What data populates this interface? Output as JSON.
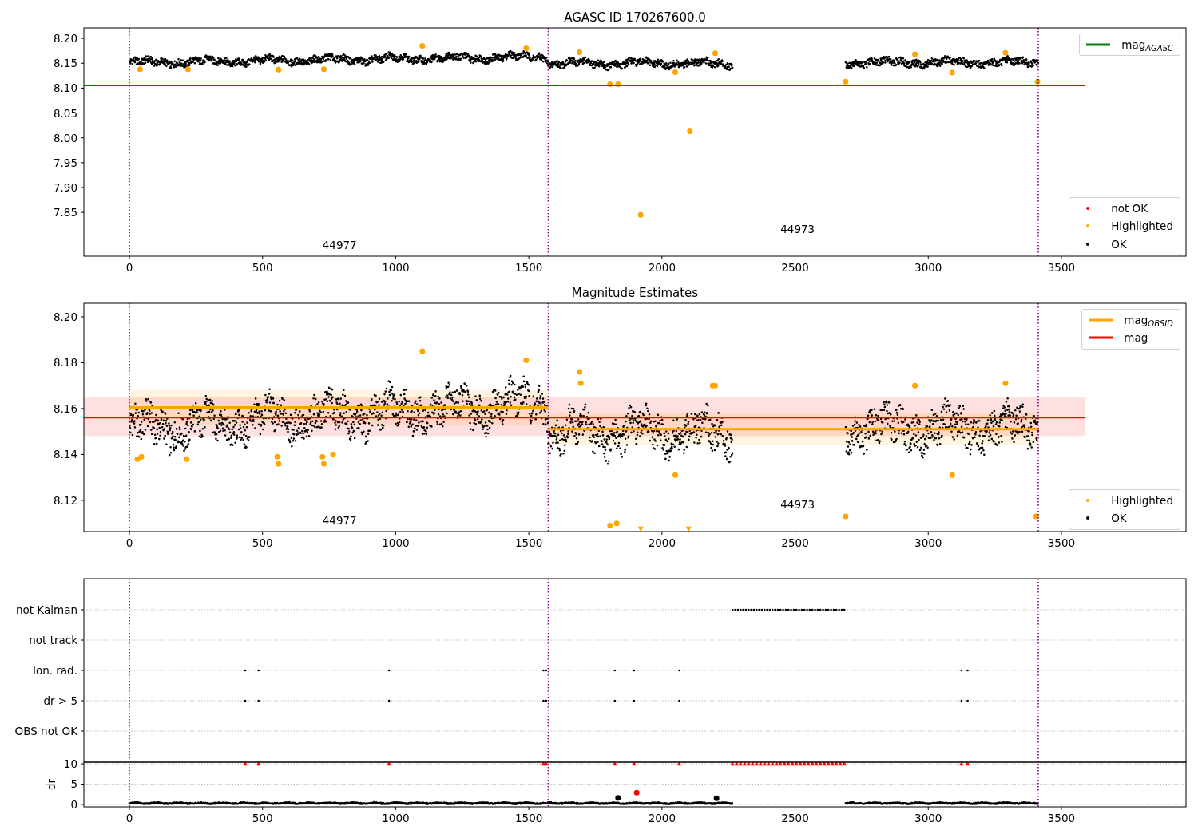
{
  "panels": [
    {
      "chart_data": {
        "type": "scatter",
        "title": "AGASC ID 170267600.0",
        "xlim": [
          -171,
          3968
        ],
        "ylim": [
          7.762,
          8.221
        ],
        "xticks": [
          0,
          500,
          1000,
          1500,
          2000,
          2500,
          3000,
          3500
        ],
        "yticks": [
          {
            "value": 7.85,
            "label": "7.85"
          },
          {
            "value": 7.9,
            "label": "7.90"
          },
          {
            "value": 7.95,
            "label": "7.95"
          },
          {
            "value": 8.0,
            "label": "8.00"
          },
          {
            "value": 8.05,
            "label": "8.05"
          },
          {
            "value": 8.1,
            "label": "8.10"
          },
          {
            "value": 8.15,
            "label": "8.15"
          },
          {
            "value": 8.2,
            "label": "8.20"
          }
        ],
        "series": [
          {
            "type": "line",
            "color": "#008000",
            "x": [
              -171,
              3590
            ],
            "values": [
              8.105,
              8.105
            ]
          },
          {
            "type": "scatter",
            "marker": "circle",
            "color": "#ffa500",
            "x": [
              40,
              220,
              560,
              730,
              1100,
              1490,
              1690,
              1805,
              1835,
              1920,
              2050,
              2105,
              2200,
              2690,
              2950,
              3090,
              3290,
              3410
            ],
            "values": [
              8.138,
              8.138,
              8.137,
              8.138,
              8.185,
              8.18,
              8.172,
              8.108,
              8.108,
              7.845,
              8.132,
              8.013,
              8.17,
              8.113,
              8.168,
              8.131,
              8.171,
              8.113
            ]
          }
        ],
        "ref_lines": [
          {
            "axis": "x",
            "value": 0,
            "color": "#800080"
          },
          {
            "axis": "x",
            "value": 1573,
            "color": "#800080"
          },
          {
            "axis": "x",
            "value": 3413,
            "color": "#800080"
          }
        ],
        "annotations": [
          "44977",
          "44973"
        ]
      },
      "legends": [
        {
          "entries": [
            {
              "label": "mag$_{AGASC}$",
              "kind": "line",
              "color": "#008000"
            }
          ]
        },
        {
          "entries": [
            {
              "label": "not OK",
              "kind": "dot",
              "color": "#ff0000"
            },
            {
              "label": "Highlighted",
              "kind": "dot",
              "color": "#ffa500"
            },
            {
              "label": "OK",
              "kind": "dot",
              "color": "#000000"
            }
          ]
        }
      ]
    },
    {
      "chart_data": {
        "type": "scatter",
        "title": "Magnitude Estimates",
        "xlim": [
          -171,
          3968
        ],
        "ylim": [
          8.1064,
          8.2059
        ],
        "xticks": [
          0,
          500,
          1000,
          1500,
          2000,
          2500,
          3000,
          3500
        ],
        "yticks": [
          {
            "value": 8.12,
            "label": "8.12"
          },
          {
            "value": 8.14,
            "label": "8.14"
          },
          {
            "value": 8.16,
            "label": "8.16"
          },
          {
            "value": 8.18,
            "label": "8.18"
          },
          {
            "value": 8.2,
            "label": "8.20"
          }
        ],
        "series": [
          {
            "type": "line",
            "color": "#ff0000",
            "x": [
              -171,
              3590
            ],
            "values": [
              8.156,
              8.156
            ]
          },
          {
            "type": "line",
            "color": "#ffa500",
            "x": [
              0,
              1573,
              null,
              1573,
              3413
            ],
            "values": [
              8.1605,
              8.1605,
              null,
              8.151,
              8.151
            ]
          },
          {
            "type": "scatter",
            "marker": "circle",
            "color": "#ffa500",
            "x": [
              30,
              45,
              215,
              555,
              560,
              725,
              730,
              765,
              1100,
              1490,
              1690,
              1695,
              1805,
              1830,
              2050,
              2190,
              2200,
              2690,
              2950,
              3090,
              3290,
              3405
            ],
            "values": [
              8.138,
              8.139,
              8.138,
              8.139,
              8.136,
              8.139,
              8.136,
              8.14,
              8.185,
              8.181,
              8.176,
              8.171,
              8.109,
              8.11,
              8.131,
              8.17,
              8.17,
              8.113,
              8.17,
              8.131,
              8.171,
              8.113
            ]
          },
          {
            "type": "scatter",
            "marker": "triangle",
            "color": "#ffa500",
            "x": [
              1920,
              2100
            ],
            "values": [
              8.1075,
              8.1075
            ]
          }
        ],
        "bands": [
          {
            "axis": "y",
            "from": 8.148,
            "to": 8.165,
            "color": "#ff0000"
          },
          {
            "axis": "y",
            "from": 8.153,
            "to": 8.168,
            "color": "#ffa500"
          },
          {
            "axis": "y",
            "from": 8.144,
            "to": 8.158,
            "color": "#ffa500"
          }
        ],
        "ref_lines": [
          {
            "axis": "x",
            "value": 0,
            "color": "#800080"
          },
          {
            "axis": "x",
            "value": 1573,
            "color": "#800080"
          },
          {
            "axis": "x",
            "value": 3413,
            "color": "#800080"
          }
        ],
        "annotations": [
          "44977",
          "44973"
        ]
      },
      "legends": [
        {
          "entries": [
            {
              "label": "mag$_{OBSID}$",
              "kind": "line",
              "color": "#ffa500"
            },
            {
              "label": "mag",
              "kind": "line",
              "color": "#ff0000"
            }
          ]
        },
        {
          "entries": [
            {
              "label": "Highlighted",
              "kind": "dot",
              "color": "#ffa500"
            },
            {
              "label": "OK",
              "kind": "dot",
              "color": "#000000"
            }
          ]
        }
      ]
    },
    {
      "flag_rows": [
        {
          "label": "not Kalman"
        },
        {
          "label": "not track"
        },
        {
          "label": "Ion. rad."
        },
        {
          "label": "dr > 5"
        },
        {
          "label": "OBS not OK"
        }
      ]
    },
    {
      "chart_data": {
        "type": "scatter",
        "ylabel": "dr",
        "xlim": [
          -171,
          3968
        ],
        "ylim": [
          -0.6,
          10.4
        ],
        "xticks": [
          0,
          500,
          1000,
          1500,
          2000,
          2500,
          3000,
          3500
        ],
        "yticks": [
          {
            "value": 0,
            "label": "0"
          },
          {
            "value": 5,
            "label": "5"
          },
          {
            "value": 10,
            "label": "10"
          }
        ],
        "series": [
          {
            "type": "scatter",
            "marker": "triangle",
            "color": "#ff0000",
            "x": [
              435,
              485,
              975,
              1555,
              1565,
              1823,
              1895,
              2065,
              3125,
              3148,
              2265,
              2280,
              2295,
              2310,
              2325,
              2340,
              2355,
              2370,
              2385,
              2400,
              2415,
              2430,
              2445,
              2460,
              2475,
              2490,
              2505,
              2520,
              2535,
              2550,
              2565,
              2580,
              2595,
              2610,
              2625,
              2640,
              2655,
              2670,
              2685
            ],
            "values": [
              10,
              10,
              10,
              10,
              10,
              10,
              10,
              10,
              10,
              10,
              10,
              10,
              10,
              10,
              10,
              10,
              10,
              10,
              10,
              10,
              10,
              10,
              10,
              10,
              10,
              10,
              10,
              10,
              10,
              10,
              10,
              10,
              10,
              10,
              10,
              10,
              10,
              10,
              10
            ]
          },
          {
            "type": "scatter",
            "marker": "circle",
            "color": "#ff0000",
            "x": [
              1905
            ],
            "values": [
              2.9
            ]
          },
          {
            "type": "scatter",
            "marker": "circle",
            "color": "#000000",
            "x": [
              1835,
              2205
            ],
            "values": [
              1.6,
              1.5
            ]
          }
        ],
        "ref_lines": [
          {
            "axis": "x",
            "value": 0,
            "color": "#800080"
          },
          {
            "axis": "x",
            "value": 1573,
            "color": "#800080"
          },
          {
            "axis": "x",
            "value": 3413,
            "color": "#800080"
          }
        ]
      }
    }
  ]
}
